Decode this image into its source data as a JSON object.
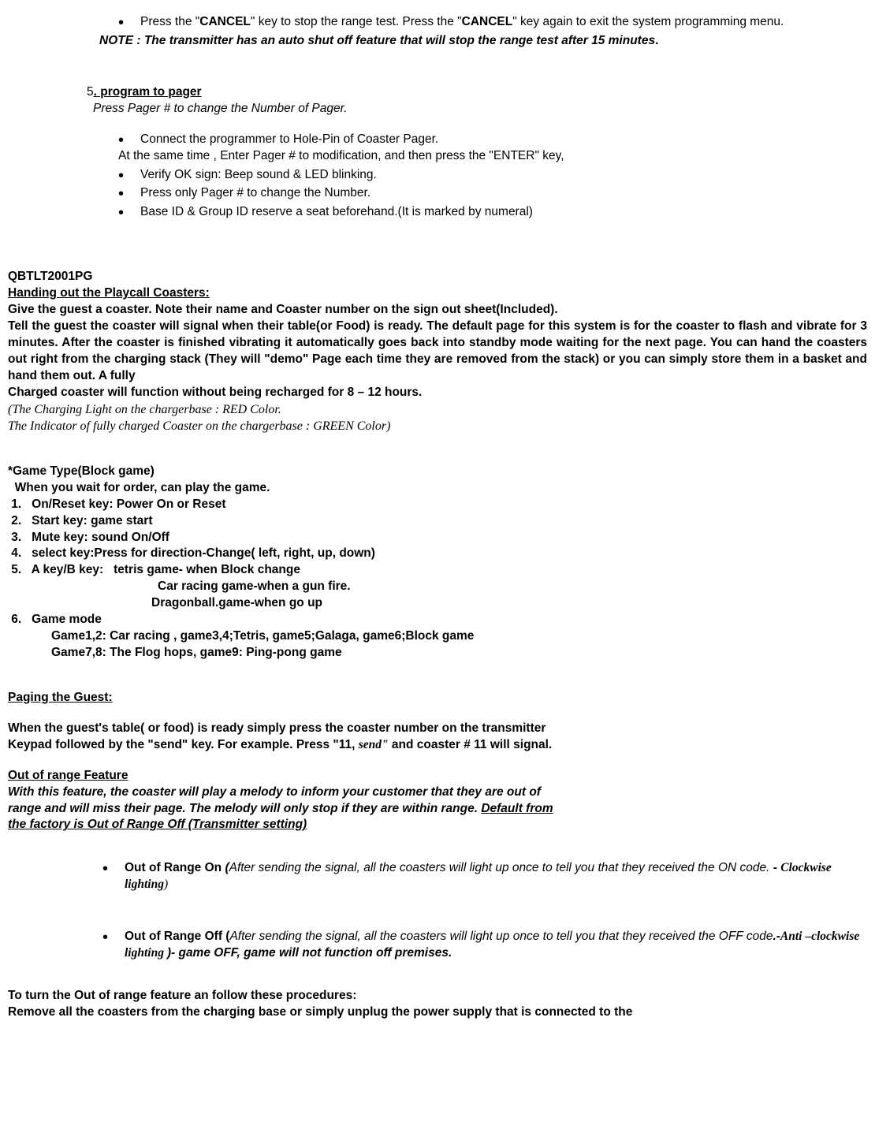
{
  "top_bullets": {
    "b1_a": "Press   the \"",
    "b1_cancel1": "CANCEL",
    "b1_b": "\" key to stop the range test.   Press the \"",
    "b1_cancel2": "CANCEL",
    "b1_c": "\" key again to exit the system programming menu."
  },
  "note_line": "NOTE : The transmitter has an auto shut off feature that will stop the range test after 15 minutes",
  "sec5": {
    "num": "5",
    "title": ". program to pager",
    "sub": "Press Pager   #   to change the Number of Pager.",
    "b1": "Connect the programmer to Hole-Pin of Coaster Pager.",
    "b1_cont": "At the same time , Enter Pager # to modification, and then press the \"ENTER\" key,",
    "b2": "Verify OK sign:   Beep sound & LED blinking.",
    "b3": "Press only Pager #   to change the Number.",
    "b4": "Base ID & Group ID   reserve a seat beforehand.(It is marked by numeral)"
  },
  "model": "QBTLT2001PG",
  "handing_title": "Handing out the Playcall Coasters:",
  "handing_p1": "Give the guest a coaster. Note their name and Coaster number on the sign out sheet(Included).",
  "handing_p2": "Tell the guest the coaster will signal when their table(or Food) is ready. The default page for this system is for the coaster to flash and vibrate for 3 minutes. After the coaster is finished vibrating it automatically goes back into standby mode waiting for the next page. You can hand the coasters out right from the charging stack (They will \"demo\" Page each time they are removed from the stack) or you can simply store them in a basket and hand them out. A fully",
  "handing_p3": "Charged coaster will function without being recharged for 8 – 12 hours.",
  "charging_note1": "(The Charging Light on the chargerbase :   RED Color.",
  "charging_note2": " The Indicator of fully charged Coaster on the chargerbase   : GREEN Color)",
  "game_title": "*Game Type(Block game)",
  "game_intro": "  When you wait for order, can play the game.",
  "game1": " 1.   On/Reset key: Power On or Reset",
  "game2": " 2.   Start key: game start",
  "game3": " 3.   Mute key: sound On/Off",
  "game4": " 4.   select key:Press for direction-Change( left, right, up, down)",
  "game5": " 5.   A key/B key:   tetris game- when Block change",
  "game5b": " Car racing game-when a gun fire.",
  "game5c": "Dragonball.game-when   go up",
  "game6": " 6.   Game mode",
  "game6b": "Game1,2: Car racing ,   game3,4;Tetris,   game5;Galaga,   game6;Block game",
  "game6c": "Game7,8: The Flog hops, game9: Ping-pong game",
  "paging_title": "Paging the Guest:",
  "paging_p1": "When the guest's table( or food) is ready simply press the coaster number on the transmitter",
  "paging_p2a": "Keypad followed by the \"send\" key. For example. Press \"11, ",
  "paging_p2_send": "send\"",
  "paging_p2b": " and coaster # 11 will signal.",
  "oor_title": "Out of range Feature",
  "oor_p1": "With this feature, the coaster will play a melody to inform your customer that they are out of",
  "oor_p2a": "range and will miss their page. The melody will only stop if they are within range. ",
  "oor_p2b": "Default from",
  "oor_p3": "the factory is Out of Range Off (Transmitter setting)",
  "oor_b1_a": "Out of Range On   ",
  "oor_b1_b": "(",
  "oor_b1_c": "After sending the signal, all the coasters will light up once to tell you that they received the ON code. ",
  "oor_b1_d": "- ",
  "oor_b1_e": "Clockwise lighting",
  "oor_b1_f": ")",
  "oor_b2_a": "Out of Range Off (",
  "oor_b2_b": "After sending the signal, all the coasters will light up once to tell you that they received the OFF code",
  "oor_b2_c": ".-",
  "oor_b2_d": "Anti –clockwise lighting ",
  "oor_b2_e": ")- game OFF, game will not function off premises.",
  "turn_p1": "To turn the Out of range feature an follow these procedures:",
  "turn_p2": "Remove all the coasters from the charging base or simply unplug the power supply that is connected to the"
}
